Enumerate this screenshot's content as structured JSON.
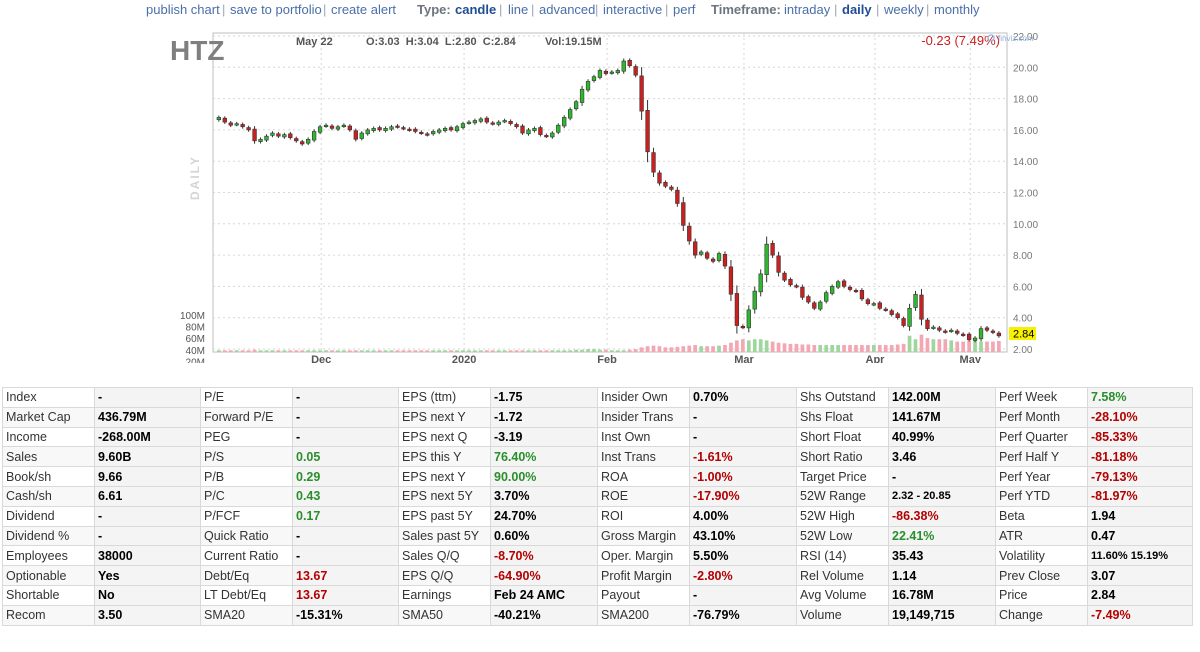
{
  "toolbar": {
    "links": [
      "publish chart",
      "save to portfolio",
      "create alert"
    ],
    "type_label": "Type:",
    "types": [
      "candle",
      "line",
      "advanced",
      "interactive",
      "perf"
    ],
    "active_type": "candle",
    "timeframe_label": "Timeframe:",
    "timeframes": [
      "intraday",
      "daily",
      "weekly",
      "monthly"
    ],
    "active_timeframe": "daily"
  },
  "chart_header": {
    "ticker": "HTZ",
    "date": "May 22",
    "ohlc": "O:3.03  H:3.04  L:2.80  C:2.84",
    "volume": "Vol:19.15M",
    "change": "-0.23 (7.49%)",
    "watermark": "finviz.com",
    "side_label": "DAILY",
    "last_price_badge": "2.84"
  },
  "colors": {
    "up": "#2eb82e",
    "down": "#cc1f1f",
    "vol_up": "#9ed69e",
    "vol_down": "#f2a7b3",
    "grid": "#d6d6d6",
    "badge": "#f7f000",
    "link": "#4a6ea9",
    "change_negative": "#cc1f1f"
  },
  "chart_data": {
    "type": "candlestick",
    "ylim": [
      2,
      22
    ],
    "price_ticks": [
      "22.00",
      "20.00",
      "18.00",
      "16.00",
      "14.00",
      "12.00",
      "10.00",
      "8.00",
      "6.00",
      "4.00",
      "2.00"
    ],
    "volume_ticks": [
      "100M",
      "80M",
      "60M",
      "40M",
      "20M"
    ],
    "x_labels": [
      "Dec",
      "2020",
      "Feb",
      "Mar",
      "Apr",
      "May"
    ],
    "closes": [
      16.8,
      16.5,
      16.3,
      16.4,
      16.2,
      16.0,
      15.3,
      15.4,
      15.6,
      15.8,
      15.6,
      15.7,
      15.5,
      15.3,
      15.1,
      15.4,
      15.9,
      16.2,
      16.3,
      16.1,
      16.2,
      16.3,
      16.0,
      15.4,
      15.8,
      16.0,
      16.1,
      16.0,
      16.1,
      16.2,
      16.2,
      16.1,
      16.0,
      15.9,
      15.8,
      15.7,
      15.9,
      16.0,
      16.1,
      16.0,
      16.2,
      16.4,
      16.5,
      16.6,
      16.7,
      16.5,
      16.4,
      16.5,
      16.6,
      16.4,
      16.2,
      15.8,
      16.0,
      16.1,
      15.7,
      15.6,
      15.8,
      16.3,
      16.8,
      17.3,
      17.8,
      18.6,
      19.1,
      19.4,
      19.8,
      19.6,
      19.7,
      19.8,
      20.4,
      20.1,
      19.5,
      17.2,
      14.6,
      13.3,
      12.6,
      12.4,
      12.2,
      11.3,
      9.9,
      8.9,
      8.0,
      8.2,
      7.8,
      7.6,
      8.1,
      7.3,
      5.5,
      3.5,
      3.4,
      4.5,
      5.7,
      6.8,
      8.7,
      8.0,
      6.9,
      6.4,
      6.1,
      6.0,
      5.3,
      5.0,
      4.6,
      5.0,
      5.6,
      6.0,
      6.3,
      6.0,
      5.8,
      5.7,
      5.2,
      4.9,
      4.9,
      4.6,
      4.5,
      4.2,
      4.0,
      3.5,
      4.6,
      5.5,
      3.9,
      3.3,
      3.4,
      3.2,
      3.1,
      3.2,
      3.0,
      2.9,
      2.6,
      2.7,
      3.3,
      3.2,
      3.07,
      2.84
    ],
    "volumes": [
      3,
      3,
      3,
      3,
      3,
      3,
      4,
      3,
      3,
      3,
      3,
      3,
      3,
      3,
      3,
      3,
      3,
      3,
      3,
      3,
      3,
      3,
      3,
      3,
      3,
      3,
      3,
      3,
      3,
      3,
      3,
      3,
      3,
      3,
      3,
      3,
      3,
      3,
      3,
      3,
      3,
      3,
      3,
      3,
      3,
      3,
      3,
      3,
      3,
      3,
      3,
      3,
      3,
      3,
      3,
      3,
      3,
      3,
      3,
      3,
      4,
      4,
      5,
      5,
      4,
      4,
      3,
      3,
      3,
      4,
      5,
      8,
      10,
      11,
      10,
      8,
      8,
      9,
      10,
      11,
      12,
      10,
      10,
      10,
      11,
      12,
      16,
      20,
      22,
      20,
      22,
      22,
      20,
      18,
      16,
      15,
      14,
      14,
      13,
      13,
      12,
      12,
      12,
      12,
      12,
      12,
      12,
      12,
      12,
      12,
      12,
      12,
      12,
      12,
      13,
      14,
      28,
      22,
      30,
      24,
      22,
      22,
      22,
      20,
      18,
      18,
      20,
      22,
      18,
      18,
      18,
      19
    ]
  },
  "snapshot": [
    [
      "Index",
      "-",
      "P/E",
      "-",
      "EPS (ttm)",
      "-1.75",
      "Insider Own",
      "0.70%",
      "Shs Outstand",
      "142.00M",
      "Perf Week",
      "7.58%"
    ],
    [
      "Market Cap",
      "436.79M",
      "Forward P/E",
      "-",
      "EPS next Y",
      "-1.72",
      "Insider Trans",
      "-",
      "Shs Float",
      "141.67M",
      "Perf Month",
      "-28.10%"
    ],
    [
      "Income",
      "-268.00M",
      "PEG",
      "-",
      "EPS next Q",
      "-3.19",
      "Inst Own",
      "-",
      "Short Float",
      "40.99%",
      "Perf Quarter",
      "-85.33%"
    ],
    [
      "Sales",
      "9.60B",
      "P/S",
      "0.05",
      "EPS this Y",
      "76.40%",
      "Inst Trans",
      "-1.61%",
      "Short Ratio",
      "3.46",
      "Perf Half Y",
      "-81.18%"
    ],
    [
      "Book/sh",
      "9.66",
      "P/B",
      "0.29",
      "EPS next Y",
      "90.00%",
      "ROA",
      "-1.00%",
      "Target Price",
      "-",
      "Perf Year",
      "-79.13%"
    ],
    [
      "Cash/sh",
      "6.61",
      "P/C",
      "0.43",
      "EPS next 5Y",
      "3.70%",
      "ROE",
      "-17.90%",
      "52W Range",
      "2.32 - 20.85",
      "Perf YTD",
      "-81.97%"
    ],
    [
      "Dividend",
      "-",
      "P/FCF",
      "0.17",
      "EPS past 5Y",
      "24.70%",
      "ROI",
      "4.00%",
      "52W High",
      "-86.38%",
      "Beta",
      "1.94"
    ],
    [
      "Dividend %",
      "-",
      "Quick Ratio",
      "-",
      "Sales past 5Y",
      "0.60%",
      "Gross Margin",
      "43.10%",
      "52W Low",
      "22.41%",
      "ATR",
      "0.47"
    ],
    [
      "Employees",
      "38000",
      "Current Ratio",
      "-",
      "Sales Q/Q",
      "-8.70%",
      "Oper. Margin",
      "5.50%",
      "RSI (14)",
      "35.43",
      "Volatility",
      "11.60% 15.19%"
    ],
    [
      "Optionable",
      "Yes",
      "Debt/Eq",
      "13.67",
      "EPS Q/Q",
      "-64.90%",
      "Profit Margin",
      "-2.80%",
      "Rel Volume",
      "1.14",
      "Prev Close",
      "3.07"
    ],
    [
      "Shortable",
      "No",
      "LT Debt/Eq",
      "13.67",
      "Earnings",
      "Feb 24 AMC",
      "Payout",
      "-",
      "Avg Volume",
      "16.78M",
      "Price",
      "2.84"
    ],
    [
      "Recom",
      "3.50",
      "SMA20",
      "-15.31%",
      "SMA50",
      "-40.21%",
      "SMA200",
      "-76.79%",
      "Volume",
      "19,149,715",
      "Change",
      "-7.49%"
    ]
  ],
  "snapshot_colors": [
    [
      "",
      "",
      "",
      "",
      "",
      "",
      "",
      "",
      "",
      "",
      "pos"
    ],
    [
      "",
      "",
      "",
      "",
      "",
      "",
      "",
      "",
      "",
      "",
      "neg"
    ],
    [
      "",
      "",
      "",
      "",
      "",
      "",
      "",
      "",
      "",
      "neg",
      "neg"
    ],
    [
      "",
      "",
      "pos",
      "",
      "pos",
      "",
      "neg",
      "",
      "",
      "",
      "neg"
    ],
    [
      "",
      "",
      "pos",
      "",
      "pos",
      "",
      "neg",
      "",
      "",
      "",
      "neg"
    ],
    [
      "",
      "",
      "pos",
      "",
      "",
      "",
      "neg",
      "",
      "small",
      "",
      "neg"
    ],
    [
      "",
      "",
      "pos",
      "",
      "",
      "",
      "",
      "",
      "neg",
      "",
      ""
    ],
    [
      "",
      "",
      "",
      "",
      "",
      "",
      "",
      "",
      "pos",
      "",
      ""
    ],
    [
      "",
      "",
      "",
      "",
      "neg",
      "",
      "",
      "",
      "",
      "",
      "small"
    ],
    [
      "",
      "",
      "neg",
      "",
      "neg",
      "",
      "neg",
      "",
      "",
      "",
      ""
    ],
    [
      "",
      "",
      "neg",
      "",
      "",
      "",
      "",
      "",
      "",
      "",
      ""
    ],
    [
      "",
      "neg",
      "",
      "neg",
      "",
      "neg",
      "",
      "neg",
      "",
      "",
      "neg"
    ]
  ]
}
